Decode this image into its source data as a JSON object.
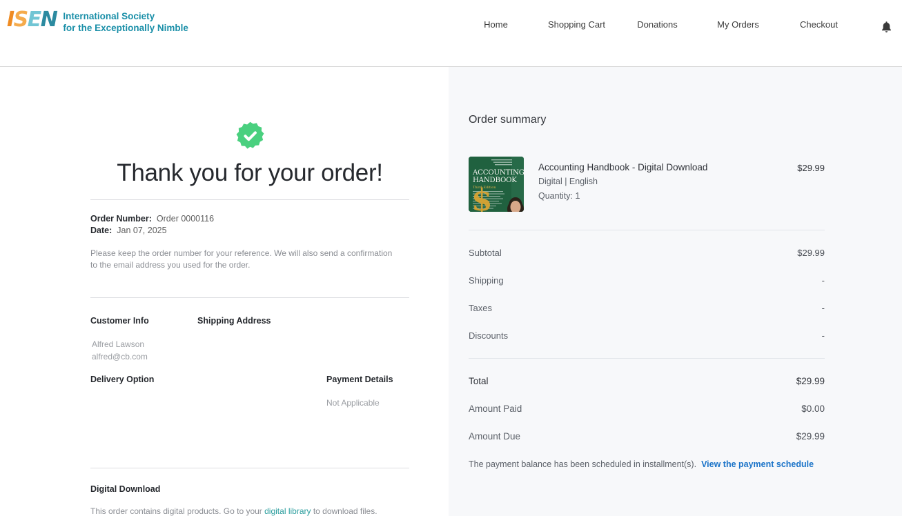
{
  "header": {
    "logo": {
      "mark_letters": [
        "I",
        "S",
        "E",
        "N"
      ],
      "name_line1": "International Society",
      "name_line2": "for the Exceptionally Nimble"
    },
    "nav": [
      {
        "label": "Home"
      },
      {
        "label": "Shopping Cart"
      },
      {
        "label": "Donations"
      },
      {
        "label": "My Orders"
      },
      {
        "label": "Checkout"
      }
    ],
    "notifications_icon": "bell-icon"
  },
  "confirmation": {
    "status_icon": "check-badge-icon",
    "status_color": "#4ad07f",
    "title": "Thank you for your order!",
    "order_number_label": "Order Number:",
    "order_number_value": "Order 0000116",
    "date_label": "Date:",
    "date_value": "Jan 07, 2025",
    "note": "Please keep the order number for your reference. We will also send a confirmation to the email address you used for the order.",
    "customer_info_heading": "Customer Info",
    "customer_name": "Alfred Lawson",
    "customer_email": "alfred@cb.com",
    "shipping_address_heading": "Shipping Address",
    "shipping_address_value": "",
    "delivery_option_heading": "Delivery Option",
    "delivery_option_value": "",
    "payment_details_heading": "Payment Details",
    "payment_details_value": "Not Applicable",
    "digital_download_heading": "Digital Download",
    "digital_download_text_before": "This order contains digital products. Go to your ",
    "digital_download_link": "digital library",
    "digital_download_text_after": " to download files.",
    "link_color": "#2a9d9d"
  },
  "summary": {
    "title": "Order summary",
    "item": {
      "cover_icon": "book-cover-accounting-handbook",
      "cover_title_line1": "ACCOUNTING",
      "cover_title_line2": "HANDBOOK",
      "cover_edition": "Third Edition",
      "title": "Accounting Handbook - Digital Download",
      "format": "Digital | English",
      "quantity": "Quantity: 1",
      "price": "$29.99"
    },
    "lines": [
      {
        "label": "Subtotal",
        "value": "$29.99"
      },
      {
        "label": "Shipping",
        "value": "-"
      },
      {
        "label": "Taxes",
        "value": "-"
      },
      {
        "label": "Discounts",
        "value": "-"
      }
    ],
    "totals": [
      {
        "label": "Total",
        "value": "$29.99"
      },
      {
        "label": "Amount Paid",
        "value": "$0.00"
      },
      {
        "label": "Amount Due",
        "value": "$29.99"
      }
    ],
    "schedule_note": "The payment balance has been scheduled in installment(s).",
    "schedule_link": "View the payment schedule",
    "schedule_link_color": "#1a73c8"
  }
}
